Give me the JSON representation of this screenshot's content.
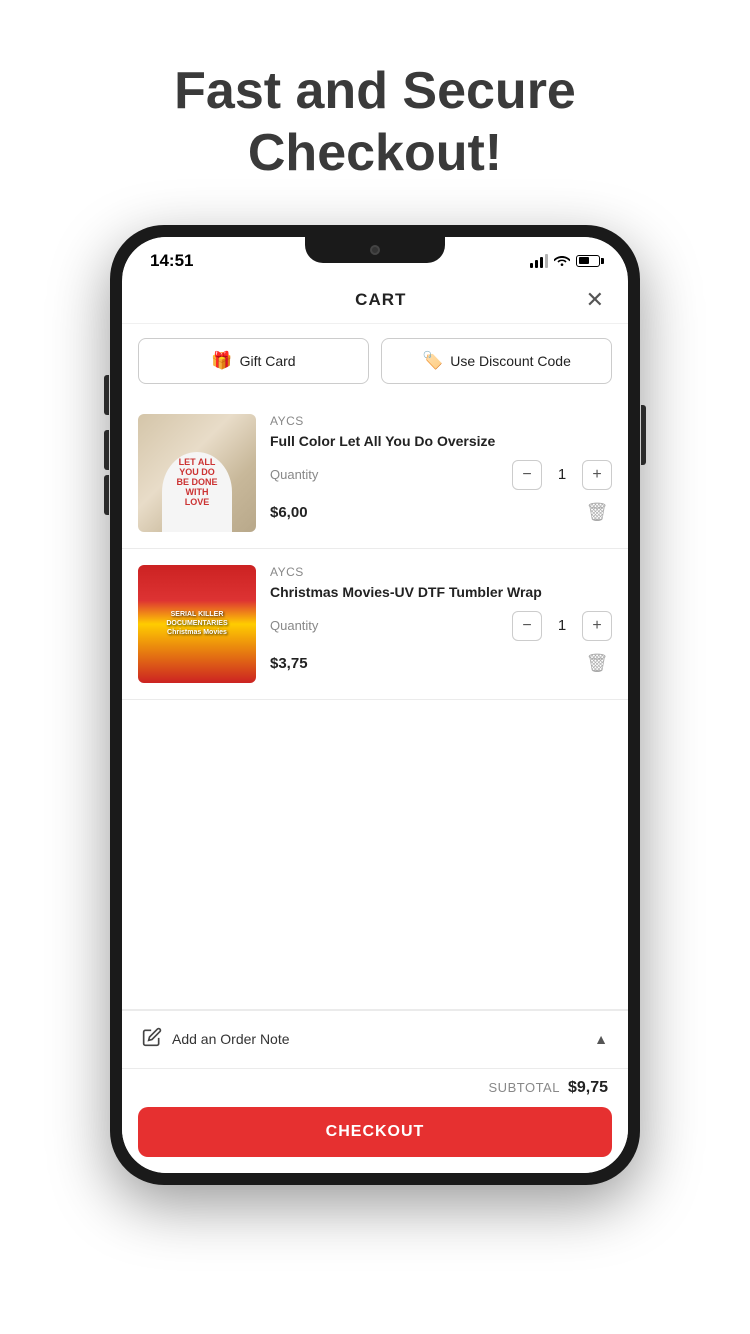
{
  "hero": {
    "title": "Fast and Secure Checkout!"
  },
  "statusBar": {
    "time": "14:51",
    "battery": "55"
  },
  "cart": {
    "title": "CART",
    "close_label": "✕",
    "gift_card_label": "Gift Card",
    "discount_code_label": "Use Discount Code",
    "items": [
      {
        "id": "item-1",
        "brand": "AYCS",
        "name": "Full Color Let All You Do Oversize",
        "quantity": 1,
        "price": "$6,00",
        "image_text": "LET ALL\nYOU DO\nBE DONE\nWITH\nLOVE"
      },
      {
        "id": "item-2",
        "brand": "AYCS",
        "name": "Christmas Movies-UV DTF Tumbler Wrap",
        "quantity": 1,
        "price": "$3,75",
        "image_text": "SERIAL KILLER\nDOCUMENTARIES\nChristmas Movies"
      }
    ],
    "order_note_label": "Add an Order Note",
    "subtotal_label": "SUBTOTAL",
    "subtotal_value": "$9,75",
    "checkout_label": "CHECKOUT"
  }
}
